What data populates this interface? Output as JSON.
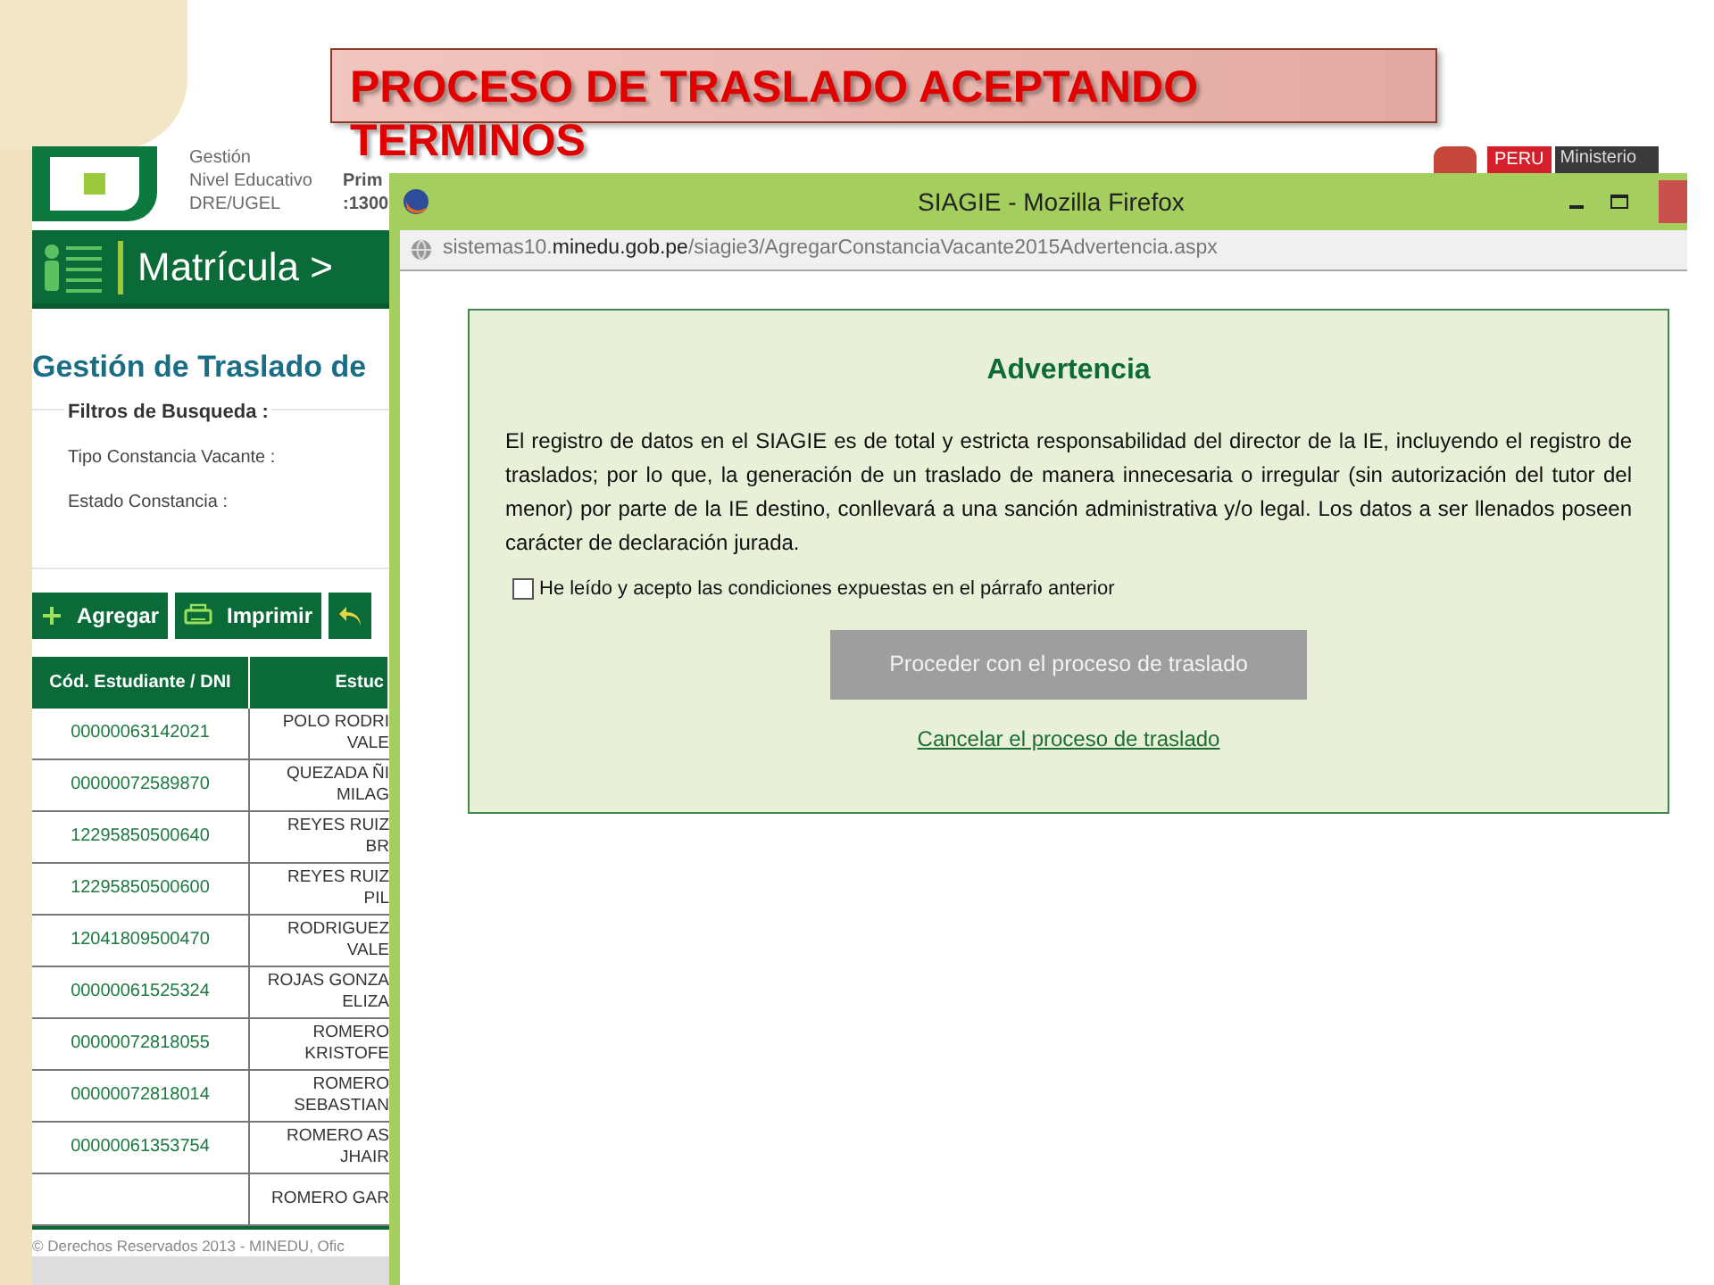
{
  "slide_title": "PROCESO DE TRASLADO ACEPTANDO TERMINOS",
  "background_page": {
    "header": [
      {
        "label": "Gestión"
      },
      {
        "label": "Nivel Educativo",
        "value": "Prim"
      },
      {
        "label": "DRE/UGEL",
        "value": ":1300"
      }
    ],
    "logo": {
      "country": "PERU",
      "ministry": "Ministerio"
    },
    "breadcrumb": "Matrícula >",
    "heading": "Gestión de Traslado de",
    "filters": {
      "legend": "Filtros de Busqueda :",
      "fields": [
        "Tipo Constancia Vacante :",
        "Estado Constancia :"
      ]
    },
    "toolbar": [
      {
        "kind": "add",
        "label": "Agregar"
      },
      {
        "kind": "print",
        "label": "Imprimir"
      },
      {
        "kind": "back"
      }
    ],
    "table": {
      "columns": [
        "Cód. Estudiante / DNI",
        "Estuc"
      ],
      "rows": [
        {
          "code": "00000063142021",
          "name": [
            "POLO RODRI",
            "VALE"
          ]
        },
        {
          "code": "00000072589870",
          "name": [
            "QUEZADA ÑI",
            "MILAG"
          ]
        },
        {
          "code": "12295850500640",
          "name": [
            "REYES RUIZ",
            "BR"
          ]
        },
        {
          "code": "12295850500600",
          "name": [
            "REYES RUIZ",
            "PIL"
          ]
        },
        {
          "code": "12041809500470",
          "name": [
            "RODRIGUEZ",
            "VALE"
          ]
        },
        {
          "code": "00000061525324",
          "name": [
            "ROJAS GONZA",
            "ELIZA"
          ]
        },
        {
          "code": "00000072818055",
          "name": [
            "ROMERO",
            "KRISTOFE"
          ]
        },
        {
          "code": "00000072818014",
          "name": [
            "ROMERO",
            "SEBASTIAN"
          ]
        },
        {
          "code": "00000061353754",
          "name": [
            "ROMERO AS",
            "JHAIR"
          ]
        },
        {
          "code": "",
          "name": [
            "ROMERO GAR"
          ]
        }
      ]
    },
    "footer": "© Derechos Reservados 2013 - MINEDU, Ofic"
  },
  "browser": {
    "title": "SIAGIE - Mozilla Firefox",
    "url_prefix": "sistemas10.",
    "url_domain": "minedu.gob.pe",
    "url_path": "/siagie3/AgregarConstanciaVacante2015Advertencia.aspx",
    "dialog": {
      "title": "Advertencia",
      "body": "El registro de datos en el SIAGIE es de total y estricta responsabilidad del director de la IE, incluyendo el registro de traslados; por lo que, la generación de un traslado de manera innecesaria o irregular (sin autorización del tutor del menor) por parte de la IE destino, conllevará a una sanción administrativa y/o legal. Los datos a ser llenados poseen carácter de declaración jurada.",
      "checkbox": {
        "label": "He leído y acepto las condiciones expuestas en el párrafo anterior",
        "checked": false
      },
      "proceed": {
        "label": "Proceder con el proceso de traslado",
        "disabled": true
      },
      "cancel": "Cancelar el proceso de traslado"
    }
  }
}
